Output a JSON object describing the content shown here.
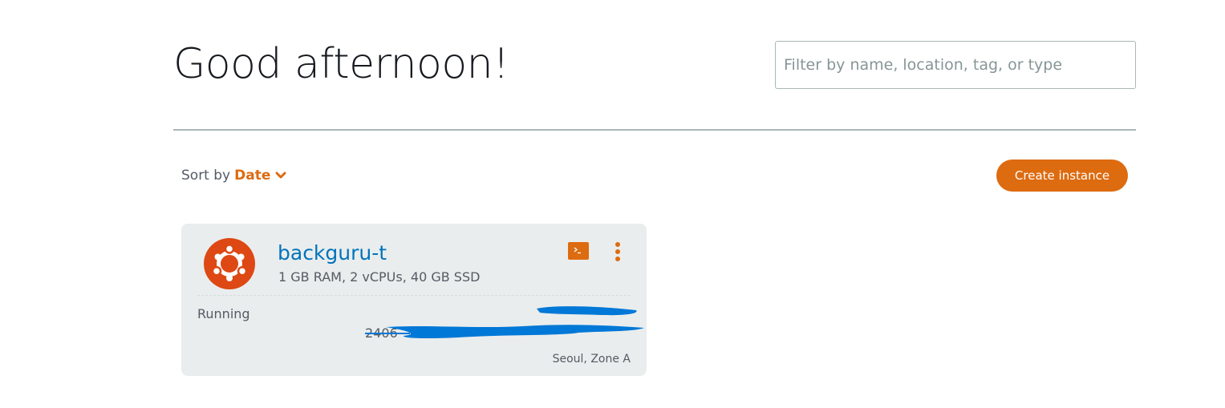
{
  "header": {
    "greeting": "Good afternoon!"
  },
  "filter": {
    "placeholder": "Filter by name, location, tag, or type"
  },
  "sort": {
    "label": "Sort by",
    "value": "Date"
  },
  "actions": {
    "create_instance_label": "Create instance"
  },
  "instances": [
    {
      "name": "backguru-t",
      "spec": "1 GB RAM, 2 vCPUs, 40 GB SSD",
      "status": "Running",
      "location": "Seoul, Zone A",
      "os_icon": "ubuntu-logo-icon",
      "ip_partial": "2406"
    }
  ],
  "colors": {
    "accent": "#dd6b10",
    "link": "#0073bb",
    "card_bg": "#eaeded",
    "redaction": "#0078d7"
  }
}
